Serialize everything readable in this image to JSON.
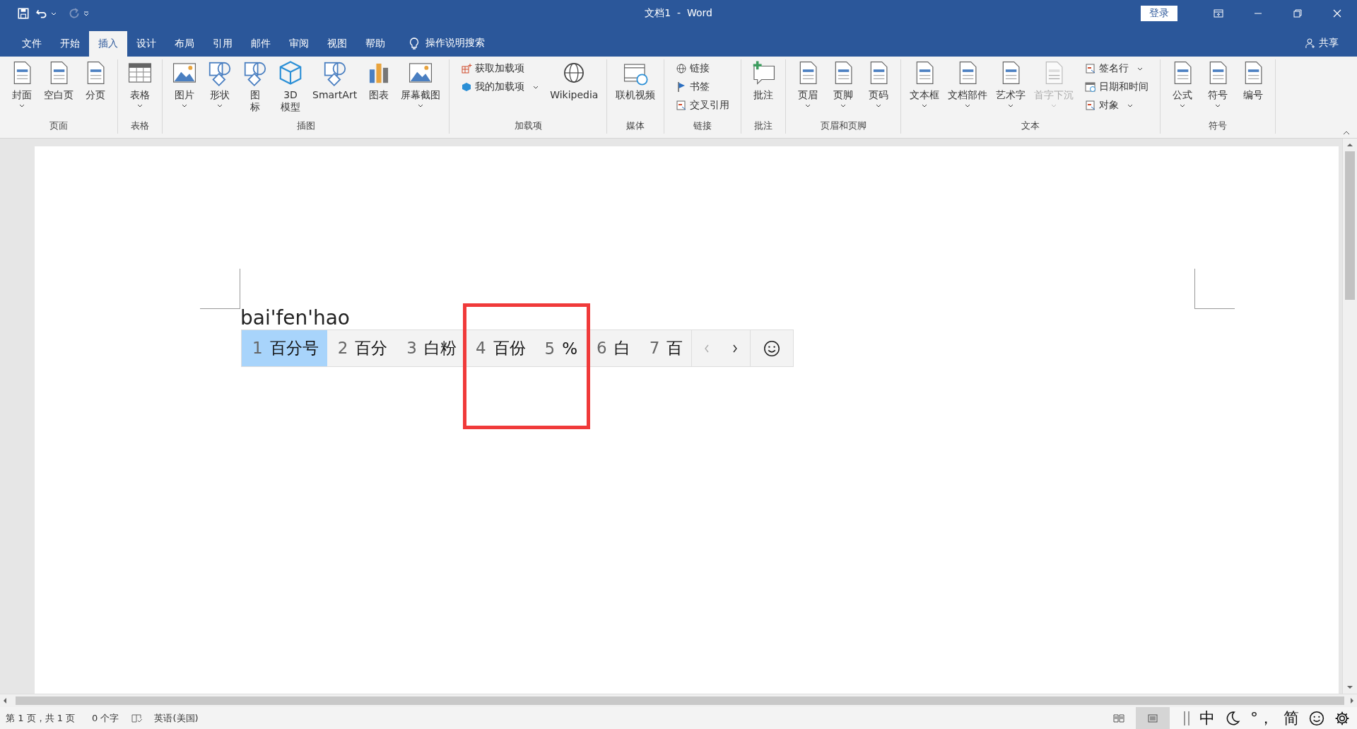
{
  "window": {
    "title": "文档1  -  Word",
    "login": "登录"
  },
  "tabs": [
    {
      "label": "文件",
      "selected": false
    },
    {
      "label": "开始",
      "selected": false
    },
    {
      "label": "插入",
      "selected": true
    },
    {
      "label": "设计",
      "selected": false
    },
    {
      "label": "布局",
      "selected": false
    },
    {
      "label": "引用",
      "selected": false
    },
    {
      "label": "邮件",
      "selected": false
    },
    {
      "label": "审阅",
      "selected": false
    },
    {
      "label": "视图",
      "selected": false
    },
    {
      "label": "帮助",
      "selected": false
    }
  ],
  "tell_me": "操作说明搜索",
  "share": "共享",
  "ribbon": [
    {
      "label": "页面",
      "items": [
        {
          "kind": "large",
          "lines": [
            "封面"
          ],
          "dropdown": true,
          "disabled": false
        },
        {
          "kind": "large",
          "lines": [
            "空白页"
          ],
          "dropdown": false,
          "disabled": false
        },
        {
          "kind": "large",
          "lines": [
            "分页"
          ],
          "dropdown": false,
          "disabled": false
        }
      ]
    },
    {
      "label": "表格",
      "items": [
        {
          "kind": "large",
          "lines": [
            "表格"
          ],
          "dropdown": true,
          "disabled": false
        }
      ]
    },
    {
      "label": "插图",
      "items": [
        {
          "kind": "large",
          "lines": [
            "图片"
          ],
          "dropdown": true,
          "disabled": false
        },
        {
          "kind": "large",
          "lines": [
            "形状"
          ],
          "dropdown": true,
          "disabled": false
        },
        {
          "kind": "large",
          "lines": [
            "图",
            "标"
          ],
          "dropdown": false,
          "disabled": false
        },
        {
          "kind": "large",
          "lines": [
            "3D",
            "模型"
          ],
          "dropdown": false,
          "disabled": false
        },
        {
          "kind": "large",
          "lines": [
            "SmartArt"
          ],
          "dropdown": false,
          "disabled": false
        },
        {
          "kind": "large",
          "lines": [
            "图表"
          ],
          "dropdown": false,
          "disabled": false
        },
        {
          "kind": "large",
          "lines": [
            "屏幕截图"
          ],
          "dropdown": true,
          "disabled": false
        }
      ]
    },
    {
      "label": "加载项",
      "items": [
        {
          "kind": "stack",
          "items": [
            {
              "label": "获取加载项",
              "dropdown": false,
              "disabled": false
            },
            {
              "label": "我的加载项",
              "dropdown": true,
              "disabled": false
            }
          ]
        },
        {
          "kind": "large",
          "lines": [
            "Wikipedia"
          ],
          "dropdown": false,
          "disabled": false
        }
      ]
    },
    {
      "label": "媒体",
      "items": [
        {
          "kind": "large",
          "lines": [
            "联机视频"
          ],
          "dropdown": false,
          "disabled": false
        }
      ]
    },
    {
      "label": "链接",
      "items": [
        {
          "kind": "stack",
          "items": [
            {
              "label": "链接",
              "dropdown": false,
              "disabled": false
            },
            {
              "label": "书签",
              "dropdown": false,
              "disabled": false
            },
            {
              "label": "交叉引用",
              "dropdown": false,
              "disabled": false
            }
          ]
        }
      ]
    },
    {
      "label": "批注",
      "items": [
        {
          "kind": "large",
          "lines": [
            "批注"
          ],
          "dropdown": false,
          "disabled": false
        }
      ]
    },
    {
      "label": "页眉和页脚",
      "items": [
        {
          "kind": "large",
          "lines": [
            "页眉"
          ],
          "dropdown": true,
          "disabled": false
        },
        {
          "kind": "large",
          "lines": [
            "页脚"
          ],
          "dropdown": true,
          "disabled": false
        },
        {
          "kind": "large",
          "lines": [
            "页码"
          ],
          "dropdown": true,
          "disabled": false
        }
      ]
    },
    {
      "label": "文本",
      "items": [
        {
          "kind": "large",
          "lines": [
            "文本框"
          ],
          "dropdown": true,
          "disabled": false
        },
        {
          "kind": "large",
          "lines": [
            "文档部件"
          ],
          "dropdown": true,
          "disabled": false
        },
        {
          "kind": "large",
          "lines": [
            "艺术字"
          ],
          "dropdown": true,
          "disabled": false
        },
        {
          "kind": "large",
          "lines": [
            "首字下沉"
          ],
          "dropdown": true,
          "disabled": true
        },
        {
          "kind": "stack",
          "items": [
            {
              "label": "签名行",
              "dropdown": true,
              "disabled": false
            },
            {
              "label": "日期和时间",
              "dropdown": false,
              "disabled": false
            },
            {
              "label": "对象",
              "dropdown": true,
              "disabled": false
            }
          ]
        }
      ]
    },
    {
      "label": "符号",
      "items": [
        {
          "kind": "large",
          "lines": [
            "公式"
          ],
          "dropdown": true,
          "disabled": false
        },
        {
          "kind": "large",
          "lines": [
            "符号"
          ],
          "dropdown": true,
          "disabled": false
        },
        {
          "kind": "large",
          "lines": [
            "编号"
          ],
          "dropdown": false,
          "disabled": false
        }
      ]
    }
  ],
  "document": {
    "typed": "bai'fen'hao"
  },
  "candidates": [
    {
      "number": "1",
      "text": "百分号",
      "selected": true
    },
    {
      "number": "2",
      "text": "百分",
      "selected": false
    },
    {
      "number": "3",
      "text": "白粉",
      "selected": false
    },
    {
      "number": "4",
      "text": "百份",
      "selected": false
    },
    {
      "number": "5",
      "text": "%",
      "selected": false
    },
    {
      "number": "6",
      "text": "白",
      "selected": false
    },
    {
      "number": "7",
      "text": "百",
      "selected": false
    }
  ],
  "candidate_paging": {
    "prev_enabled": false,
    "next_enabled": true
  },
  "status_bar": {
    "page": "第 1 页，共 1 页",
    "words": "0 个字",
    "language": "英语(美国)",
    "views": [
      {
        "selected": false
      },
      {
        "selected": true
      }
    ]
  },
  "ime": {
    "mode": "中",
    "punctuation": "°，",
    "script": "简"
  }
}
